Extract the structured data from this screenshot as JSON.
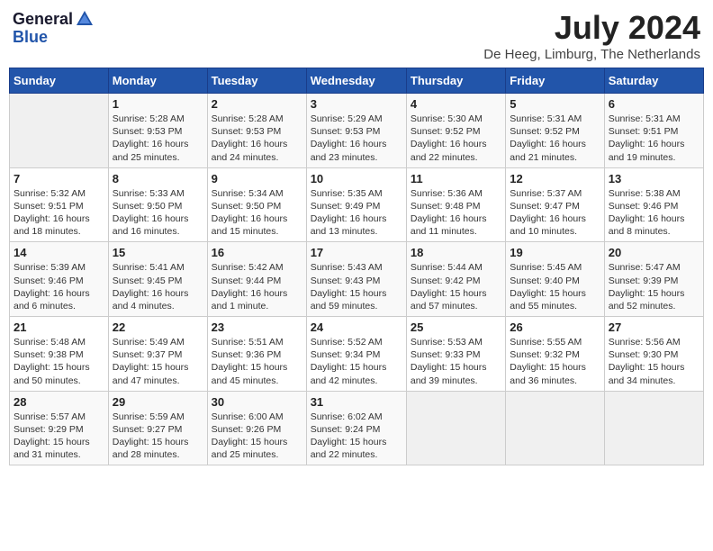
{
  "header": {
    "logo_general": "General",
    "logo_blue": "Blue",
    "main_title": "July 2024",
    "subtitle": "De Heeg, Limburg, The Netherlands"
  },
  "calendar": {
    "days_of_week": [
      "Sunday",
      "Monday",
      "Tuesday",
      "Wednesday",
      "Thursday",
      "Friday",
      "Saturday"
    ],
    "weeks": [
      [
        {
          "day": "",
          "info": ""
        },
        {
          "day": "1",
          "info": "Sunrise: 5:28 AM\nSunset: 9:53 PM\nDaylight: 16 hours\nand 25 minutes."
        },
        {
          "day": "2",
          "info": "Sunrise: 5:28 AM\nSunset: 9:53 PM\nDaylight: 16 hours\nand 24 minutes."
        },
        {
          "day": "3",
          "info": "Sunrise: 5:29 AM\nSunset: 9:53 PM\nDaylight: 16 hours\nand 23 minutes."
        },
        {
          "day": "4",
          "info": "Sunrise: 5:30 AM\nSunset: 9:52 PM\nDaylight: 16 hours\nand 22 minutes."
        },
        {
          "day": "5",
          "info": "Sunrise: 5:31 AM\nSunset: 9:52 PM\nDaylight: 16 hours\nand 21 minutes."
        },
        {
          "day": "6",
          "info": "Sunrise: 5:31 AM\nSunset: 9:51 PM\nDaylight: 16 hours\nand 19 minutes."
        }
      ],
      [
        {
          "day": "7",
          "info": "Sunrise: 5:32 AM\nSunset: 9:51 PM\nDaylight: 16 hours\nand 18 minutes."
        },
        {
          "day": "8",
          "info": "Sunrise: 5:33 AM\nSunset: 9:50 PM\nDaylight: 16 hours\nand 16 minutes."
        },
        {
          "day": "9",
          "info": "Sunrise: 5:34 AM\nSunset: 9:50 PM\nDaylight: 16 hours\nand 15 minutes."
        },
        {
          "day": "10",
          "info": "Sunrise: 5:35 AM\nSunset: 9:49 PM\nDaylight: 16 hours\nand 13 minutes."
        },
        {
          "day": "11",
          "info": "Sunrise: 5:36 AM\nSunset: 9:48 PM\nDaylight: 16 hours\nand 11 minutes."
        },
        {
          "day": "12",
          "info": "Sunrise: 5:37 AM\nSunset: 9:47 PM\nDaylight: 16 hours\nand 10 minutes."
        },
        {
          "day": "13",
          "info": "Sunrise: 5:38 AM\nSunset: 9:46 PM\nDaylight: 16 hours\nand 8 minutes."
        }
      ],
      [
        {
          "day": "14",
          "info": "Sunrise: 5:39 AM\nSunset: 9:46 PM\nDaylight: 16 hours\nand 6 minutes."
        },
        {
          "day": "15",
          "info": "Sunrise: 5:41 AM\nSunset: 9:45 PM\nDaylight: 16 hours\nand 4 minutes."
        },
        {
          "day": "16",
          "info": "Sunrise: 5:42 AM\nSunset: 9:44 PM\nDaylight: 16 hours\nand 1 minute."
        },
        {
          "day": "17",
          "info": "Sunrise: 5:43 AM\nSunset: 9:43 PM\nDaylight: 15 hours\nand 59 minutes."
        },
        {
          "day": "18",
          "info": "Sunrise: 5:44 AM\nSunset: 9:42 PM\nDaylight: 15 hours\nand 57 minutes."
        },
        {
          "day": "19",
          "info": "Sunrise: 5:45 AM\nSunset: 9:40 PM\nDaylight: 15 hours\nand 55 minutes."
        },
        {
          "day": "20",
          "info": "Sunrise: 5:47 AM\nSunset: 9:39 PM\nDaylight: 15 hours\nand 52 minutes."
        }
      ],
      [
        {
          "day": "21",
          "info": "Sunrise: 5:48 AM\nSunset: 9:38 PM\nDaylight: 15 hours\nand 50 minutes."
        },
        {
          "day": "22",
          "info": "Sunrise: 5:49 AM\nSunset: 9:37 PM\nDaylight: 15 hours\nand 47 minutes."
        },
        {
          "day": "23",
          "info": "Sunrise: 5:51 AM\nSunset: 9:36 PM\nDaylight: 15 hours\nand 45 minutes."
        },
        {
          "day": "24",
          "info": "Sunrise: 5:52 AM\nSunset: 9:34 PM\nDaylight: 15 hours\nand 42 minutes."
        },
        {
          "day": "25",
          "info": "Sunrise: 5:53 AM\nSunset: 9:33 PM\nDaylight: 15 hours\nand 39 minutes."
        },
        {
          "day": "26",
          "info": "Sunrise: 5:55 AM\nSunset: 9:32 PM\nDaylight: 15 hours\nand 36 minutes."
        },
        {
          "day": "27",
          "info": "Sunrise: 5:56 AM\nSunset: 9:30 PM\nDaylight: 15 hours\nand 34 minutes."
        }
      ],
      [
        {
          "day": "28",
          "info": "Sunrise: 5:57 AM\nSunset: 9:29 PM\nDaylight: 15 hours\nand 31 minutes."
        },
        {
          "day": "29",
          "info": "Sunrise: 5:59 AM\nSunset: 9:27 PM\nDaylight: 15 hours\nand 28 minutes."
        },
        {
          "day": "30",
          "info": "Sunrise: 6:00 AM\nSunset: 9:26 PM\nDaylight: 15 hours\nand 25 minutes."
        },
        {
          "day": "31",
          "info": "Sunrise: 6:02 AM\nSunset: 9:24 PM\nDaylight: 15 hours\nand 22 minutes."
        },
        {
          "day": "",
          "info": ""
        },
        {
          "day": "",
          "info": ""
        },
        {
          "day": "",
          "info": ""
        }
      ]
    ]
  }
}
